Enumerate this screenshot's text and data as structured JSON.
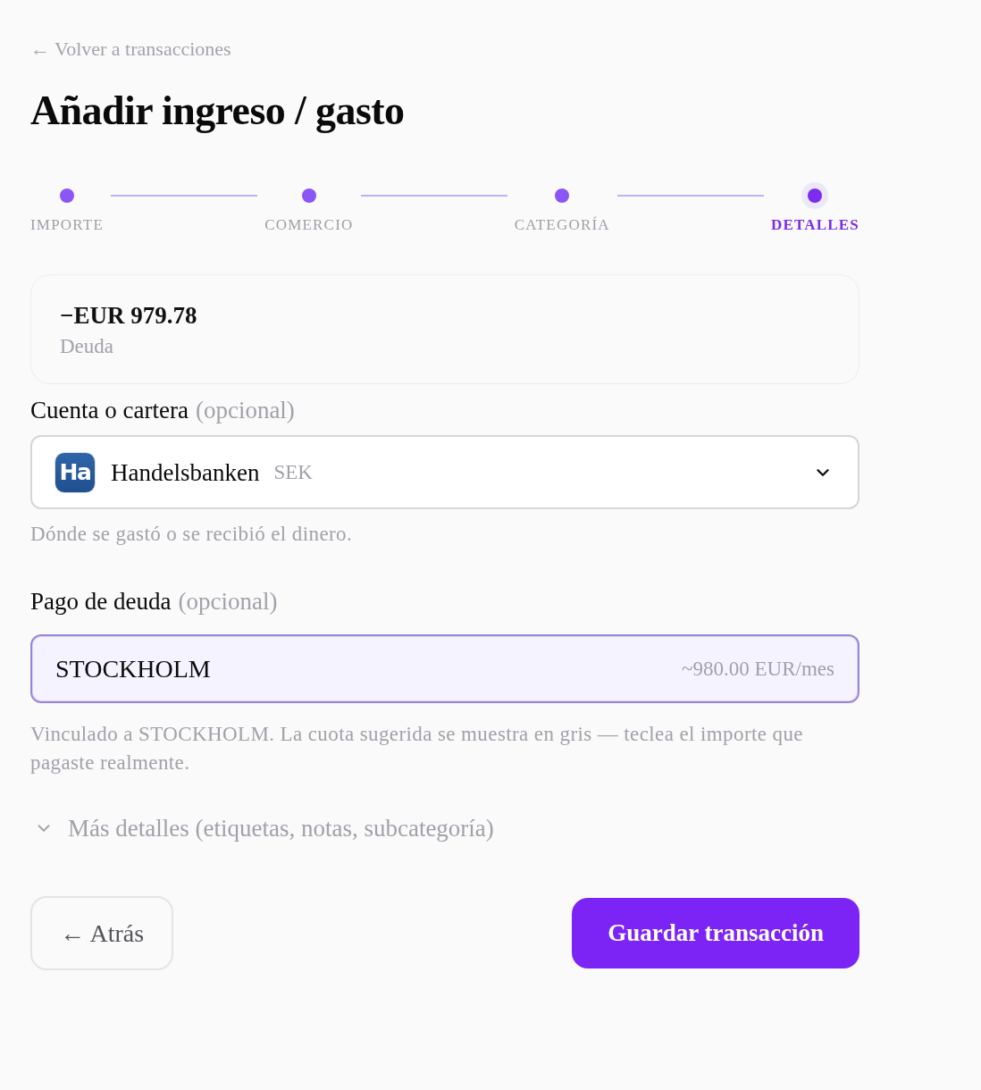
{
  "back_link": {
    "label": "← Volver a transacciones"
  },
  "title": "Añadir ingreso / gasto",
  "steps": [
    {
      "label": "IMPORTE",
      "selected": false
    },
    {
      "label": "COMERCIO",
      "selected": false
    },
    {
      "label": "CATEGORÍA",
      "selected": false
    },
    {
      "label": "DETALLES",
      "selected": true
    }
  ],
  "summary": {
    "amount": "−EUR 979.78",
    "type": "Deuda"
  },
  "account": {
    "label": "Cuenta o cartera",
    "optional": "(opcional)",
    "logo_text": "Ha",
    "value": "Handelsbanken",
    "currency": "SEK",
    "hint": "Dónde se gastó o se recibió el dinero."
  },
  "debt_payment": {
    "label": "Pago de deuda",
    "optional": "(opcional)",
    "value": "STOCKHOLM",
    "suggestion": "~980.00 EUR/mes",
    "focused": true,
    "hint": "Vinculado a STOCKHOLM. La cuota sugerida se muestra en gris — teclea el importe que pagaste realmente."
  },
  "more_details": {
    "label": "Más detalles (etiquetas, notas, subcategoría)",
    "expanded": false
  },
  "buttons": [
    {
      "label": "← Atrás",
      "kind": "secondary"
    },
    {
      "label": "Guardar transacción",
      "kind": "primary"
    }
  ]
}
